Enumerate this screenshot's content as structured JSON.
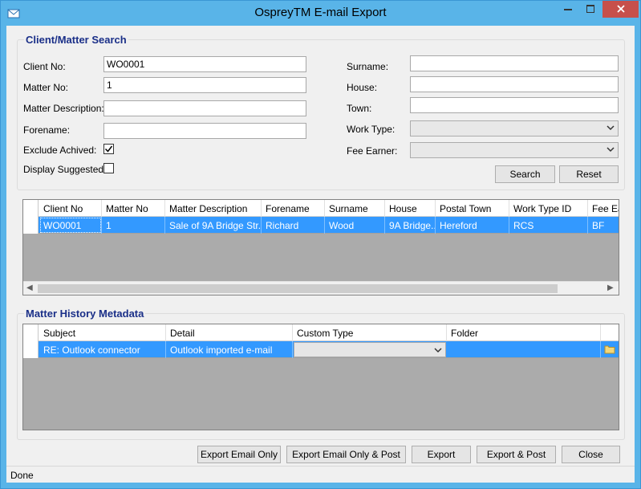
{
  "window": {
    "title": "OspreyTM E-mail Export"
  },
  "search": {
    "group_title": "Client/Matter Search",
    "client_no_label": "Client No:",
    "client_no_value": "WO0001",
    "matter_no_label": "Matter No:",
    "matter_no_value": "1",
    "matter_desc_label": "Matter Description:",
    "matter_desc_value": "",
    "forename_label": "Forename:",
    "forename_value": "",
    "exclude_label": "Exclude Achived:",
    "exclude_checked": true,
    "display_label": "Display Suggested:",
    "display_checked": false,
    "surname_label": "Surname:",
    "surname_value": "",
    "house_label": "House:",
    "house_value": "",
    "town_label": "Town:",
    "town_value": "",
    "worktype_label": "Work Type:",
    "feeearner_label": "Fee Earner:",
    "search_button": "Search",
    "reset_button": "Reset"
  },
  "matters": {
    "columns": [
      "Client No",
      "Matter No",
      "Matter Description",
      "Forename",
      "Surname",
      "House",
      "Postal Town",
      "Work Type ID",
      "Fee Ea"
    ],
    "rows": [
      [
        "WO0001",
        "1",
        "Sale of 9A Bridge Str...",
        "Richard",
        "Wood",
        "9A Bridge...",
        "Hereford",
        "RCS",
        "BF"
      ]
    ]
  },
  "history": {
    "group_title": "Matter History Metadata",
    "columns": [
      "Subject",
      "Detail",
      "Custom Type",
      "Folder"
    ],
    "rows": [
      [
        "RE: Outlook connector",
        "Outlook imported e-mail",
        "",
        ""
      ]
    ]
  },
  "actions": {
    "export_email_only": "Export Email Only",
    "export_email_only_post": "Export Email Only & Post",
    "export": "Export",
    "export_post": "Export & Post",
    "close": "Close"
  },
  "status": {
    "text": "Done"
  },
  "colors": {
    "titlebar": "#59b4e8",
    "selection": "#3399ff",
    "group_title": "#1a2f88",
    "close_button": "#c7504b"
  },
  "icons": {
    "app": "email-app-icon",
    "folder": "folder-icon",
    "check": "checkmark-icon"
  }
}
